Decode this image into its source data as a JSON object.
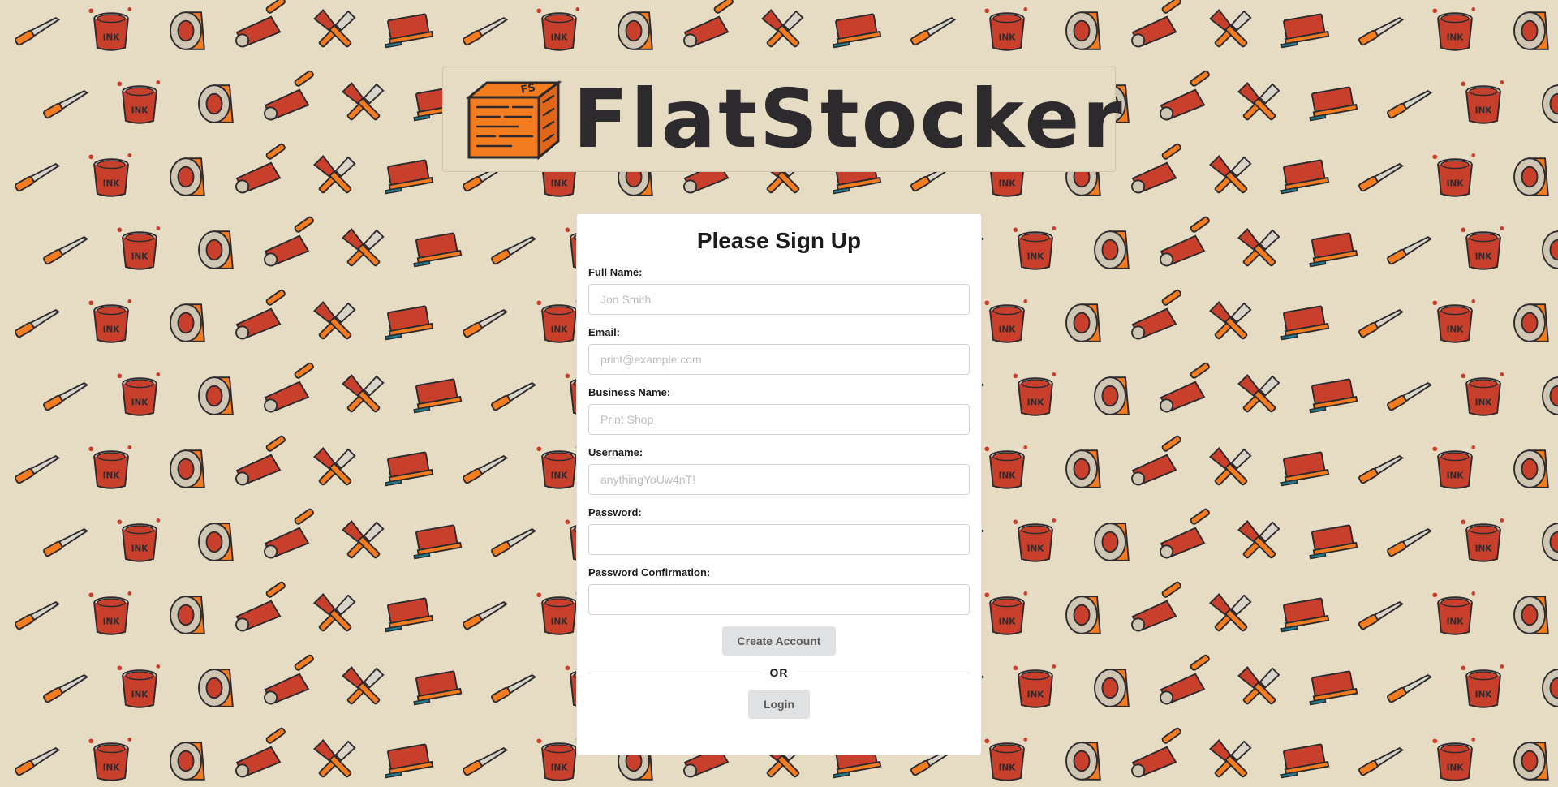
{
  "brand": {
    "name": "FlatStocker",
    "logo_icon": "cardboard-box-icon",
    "logo_color": "#f47c20"
  },
  "background": {
    "color": "#e6dcc3",
    "pattern_icons": [
      "palette-knife-icon",
      "ink-bucket-icon",
      "tape-roll-icon",
      "paint-roller-icon",
      "crossed-tools-icon",
      "squeegee-icon"
    ],
    "ink_label": "INK",
    "colors": {
      "orange": "#f47c20",
      "red": "#c8402c",
      "teal": "#1f7a8c",
      "outline": "#2d2a2e"
    }
  },
  "form": {
    "title": "Please Sign Up",
    "fields": [
      {
        "label": "Full Name:",
        "placeholder": "Jon Smith",
        "type": "text"
      },
      {
        "label": "Email:",
        "placeholder": "print@example.com",
        "type": "email"
      },
      {
        "label": "Business Name:",
        "placeholder": "Print Shop",
        "type": "text"
      },
      {
        "label": "Username:",
        "placeholder": "anythingYoUw4nT!",
        "type": "text"
      },
      {
        "label": "Password:",
        "placeholder": "",
        "type": "password"
      },
      {
        "label": "Password Confirmation:",
        "placeholder": "",
        "type": "password"
      }
    ],
    "create_button": "Create Account",
    "divider_text": "OR",
    "login_button": "Login"
  }
}
